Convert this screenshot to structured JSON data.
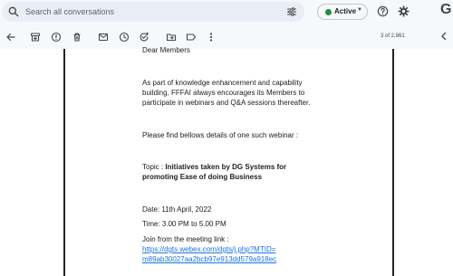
{
  "search": {
    "placeholder": "Search all conversations"
  },
  "status": {
    "label": "Active",
    "color": "#1e8e3e"
  },
  "brand": {
    "logo_text": "G"
  },
  "pager": {
    "text": "3 of 2,861"
  },
  "email": {
    "greeting": "Dear Members",
    "para1_line1": "As part of knowledge enhancement and capability",
    "para1_line2": "building, FFFAI always encourages its Members to",
    "para1_line3": "participate in webinars and Q&A sessions thereafter.",
    "para2": "Please find bellows details of one such webinar :",
    "topic_label": "Topic : ",
    "topic_line1": "Initiatives taken by DG Systems for",
    "topic_line2": "promoting Ease of doing Business",
    "date": "Date: 11th April, 2022",
    "time": "Time: 3.00 PM to 5.00 PM",
    "join_label": "Join from the meeting link :",
    "link_line1": "https://dgts.webex.com/dgts/j.php?MTID=",
    "link_line2": "m89ab30027aa2bcb97e913dd579a918ec"
  }
}
